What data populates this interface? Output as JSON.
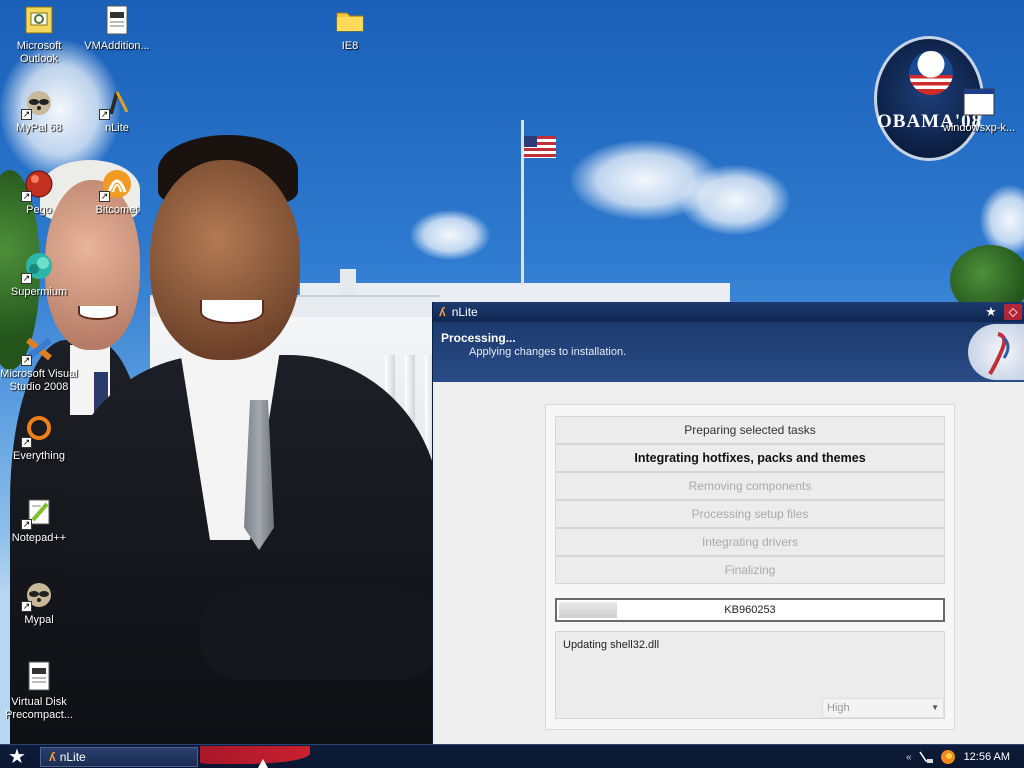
{
  "desktop": {
    "icons": [
      {
        "label": "Microsoft Outlook",
        "icon": "outlook-icon"
      },
      {
        "label": "VMAddition...",
        "icon": "document-icon"
      },
      {
        "label": "IE8",
        "icon": "folder-icon"
      },
      {
        "label": "MyPal 68",
        "icon": "raccoon-icon"
      },
      {
        "label": "nLite",
        "icon": "nlite-icon"
      },
      {
        "label": "Pego",
        "icon": "pego-icon"
      },
      {
        "label": "Bitcomet",
        "icon": "bitcomet-icon"
      },
      {
        "label": "Supermium",
        "icon": "supermium-icon"
      },
      {
        "label": "Microsoft Visual Studio 2008",
        "icon": "visual-studio-icon"
      },
      {
        "label": "Everything",
        "icon": "everything-icon"
      },
      {
        "label": "Notepad++",
        "icon": "notepad-plus-plus-icon"
      },
      {
        "label": "Mypal",
        "icon": "raccoon-icon"
      },
      {
        "label": "Virtual Disk Precompact...",
        "icon": "document-icon"
      },
      {
        "label": "windowsxp-k...",
        "icon": "window-icon"
      }
    ],
    "wallpaper_logo": "OBAMA'08"
  },
  "window": {
    "title": "nLite",
    "banner": {
      "title": "Processing...",
      "subtitle": "Applying changes to installation."
    },
    "steps": [
      {
        "label": "Preparing selected tasks",
        "state": "done"
      },
      {
        "label": "Integrating hotfixes, packs and themes",
        "state": "active"
      },
      {
        "label": "Removing components",
        "state": "pending"
      },
      {
        "label": "Processing setup files",
        "state": "pending"
      },
      {
        "label": "Integrating drivers",
        "state": "pending"
      },
      {
        "label": "Finalizing",
        "state": "pending"
      }
    ],
    "progress": {
      "label": "KB960253",
      "fraction": 0.16
    },
    "log": {
      "text": "Updating shell32.dll"
    },
    "priority": {
      "selected": "High"
    }
  },
  "taskbar": {
    "task_label": "nLite",
    "clock": "12:56 AM",
    "tray_chevron": "«"
  }
}
